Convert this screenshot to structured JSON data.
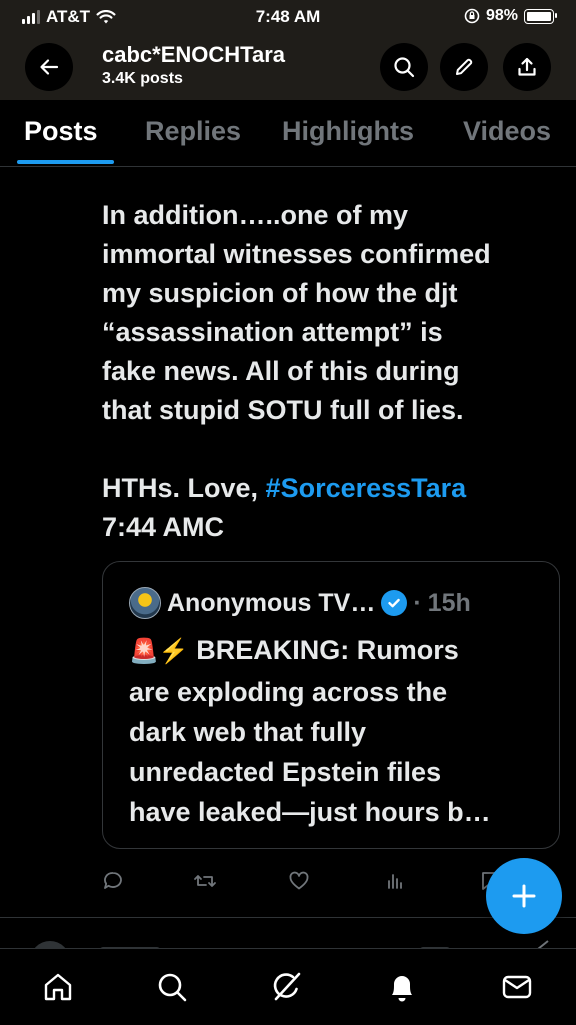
{
  "status_bar": {
    "carrier": "AT&T",
    "time": "7:48 AM",
    "battery": "98%",
    "icons": [
      "signal-icon",
      "wifi-icon",
      "orientation-lock-icon",
      "battery-icon"
    ]
  },
  "profile_header": {
    "name": "cabc*ENOCHTara",
    "posts_count": "3.4K posts",
    "buttons": [
      "back-arrow-icon",
      "search-icon",
      "pencil-icon",
      "share-icon"
    ]
  },
  "tabs": [
    {
      "label": "Posts",
      "active": true
    },
    {
      "label": "Replies",
      "active": false
    },
    {
      "label": "Highlights",
      "active": false
    },
    {
      "label": "Videos",
      "active": false
    }
  ],
  "post": {
    "lines": [
      "In addition…..one of my",
      "immortal witnesses confirmed",
      "my suspicion of how the djt",
      "“assassination attempt” is",
      "fake news. All of this during",
      "that stupid SOTU full of lies."
    ],
    "signoff_prefix": "HTHs. Love,",
    "hashtag": "#SorceressTara",
    "time_line": "7:44 AMC",
    "quote": {
      "author": "Anonymous TV…",
      "separator": "·",
      "age": "15h",
      "text_line1": "BREAKING: Rumors",
      "text_rest": [
        "are exploding across the",
        "dark web that fully",
        "unredacted Epstein files",
        "have leaked—just hours b…"
      ],
      "emoji": [
        "🚨",
        "⚡"
      ]
    },
    "actions": [
      "reply-icon",
      "repost-icon",
      "like-icon",
      "views-icon",
      "bookmark-icon"
    ]
  },
  "fab": {
    "icon": "plus-icon"
  },
  "bottom_nav": [
    "home-icon",
    "search-icon",
    "grok-icon",
    "notifications-icon",
    "messages-icon"
  ],
  "colors": {
    "accent": "#1d9bf0",
    "background": "#000000",
    "header": "#1f1d19",
    "muted": "#71767b"
  }
}
